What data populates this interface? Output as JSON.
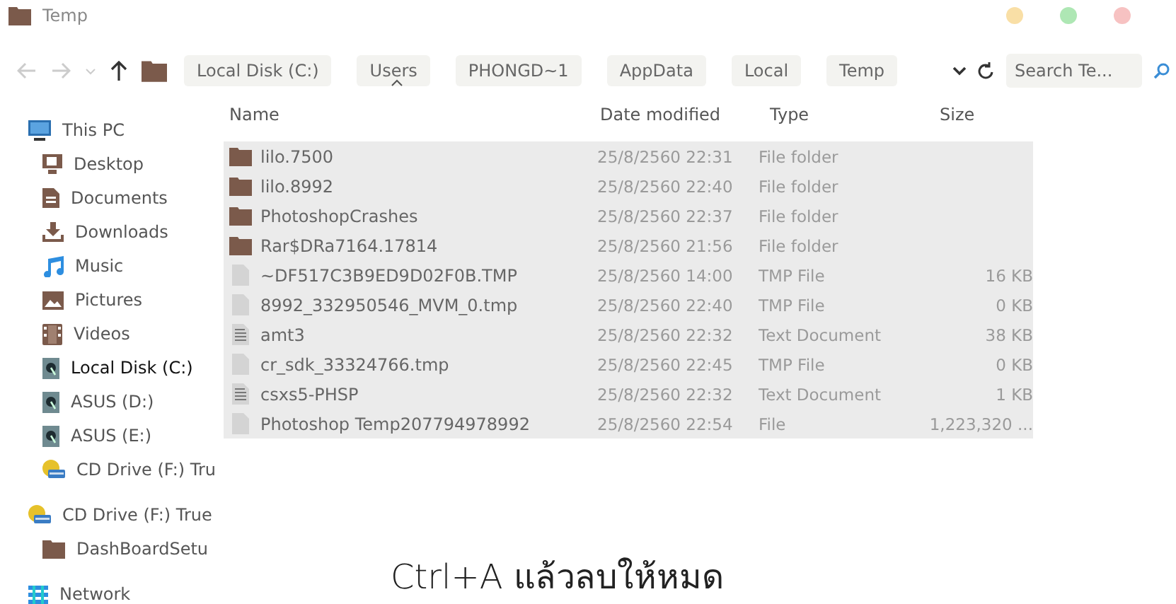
{
  "window": {
    "title": "Temp"
  },
  "breadcrumb": [
    {
      "label": "Local Disk (C:)"
    },
    {
      "label": "Users"
    },
    {
      "label": "PHONGD~1"
    },
    {
      "label": "AppData"
    },
    {
      "label": "Local"
    },
    {
      "label": "Temp"
    }
  ],
  "search": {
    "placeholder": "Search Te..."
  },
  "columns": [
    "Name",
    "Date modified",
    "Type",
    "Size"
  ],
  "sidebar": {
    "items": [
      {
        "label": "This PC",
        "kind": "pc",
        "selected": false,
        "children": [
          {
            "label": "Desktop",
            "kind": "desktop",
            "selected": false
          },
          {
            "label": "Documents",
            "kind": "documents",
            "selected": false
          },
          {
            "label": "Downloads",
            "kind": "downloads",
            "selected": false
          },
          {
            "label": "Music",
            "kind": "music",
            "selected": false
          },
          {
            "label": "Pictures",
            "kind": "pictures",
            "selected": false
          },
          {
            "label": "Videos",
            "kind": "videos",
            "selected": false
          },
          {
            "label": "Local Disk (C:)",
            "kind": "disk",
            "selected": true
          },
          {
            "label": "ASUS (D:)",
            "kind": "disk",
            "selected": false
          },
          {
            "label": "ASUS (E:)",
            "kind": "disk",
            "selected": false
          },
          {
            "label": "CD Drive (F:) Tru",
            "kind": "cd",
            "selected": false
          }
        ]
      },
      {
        "label": "CD Drive (F:) True",
        "kind": "cd",
        "selected": false,
        "children": [
          {
            "label": "DashBoardSetu",
            "kind": "folder",
            "selected": false
          }
        ]
      },
      {
        "label": "Network",
        "kind": "network",
        "selected": false
      }
    ]
  },
  "files": [
    {
      "name": "lilo.7500",
      "date": "25/8/2560 22:31",
      "type": "File folder",
      "kind": "folder",
      "selected": true
    },
    {
      "name": "lilo.8992",
      "date": "25/8/2560 22:40",
      "type": "File folder",
      "kind": "folder",
      "selected": true
    },
    {
      "name": "PhotoshopCrashes",
      "date": "25/8/2560 22:37",
      "type": "File folder",
      "kind": "folder",
      "selected": true
    },
    {
      "name": "Rar$DRa7164.17814",
      "date": "25/8/2560 21:56",
      "type": "File folder",
      "kind": "folder",
      "selected": true
    },
    {
      "name": "~DF517C3B9ED9D02F0B.TMP",
      "date": "25/8/2560 14:00",
      "type": "TMP File",
      "size": "16 KB",
      "kind": "file",
      "selected": true
    },
    {
      "name": "8992_332950546_MVM_0.tmp",
      "date": "25/8/2560 22:40",
      "type": "TMP File",
      "size": "0 KB",
      "kind": "file",
      "selected": true
    },
    {
      "name": "amt3",
      "date": "25/8/2560 22:32",
      "type": "Text Document",
      "size": "38 KB",
      "kind": "text",
      "selected": true
    },
    {
      "name": "cr_sdk_33324766.tmp",
      "date": "25/8/2560 22:45",
      "type": "TMP File",
      "size": "0 KB",
      "kind": "file",
      "selected": true
    },
    {
      "name": "csxs5-PHSP",
      "date": "25/8/2560 22:32",
      "type": "Text Document",
      "size": "1 KB",
      "kind": "text",
      "selected": true
    },
    {
      "name": "Photoshop Temp207794978992",
      "date": "25/8/2560 22:54",
      "type": "File",
      "size": "1,223,320 ...",
      "kind": "file",
      "selected": true
    }
  ],
  "caption": "Ctrl+A แล้วลบให้หมด"
}
